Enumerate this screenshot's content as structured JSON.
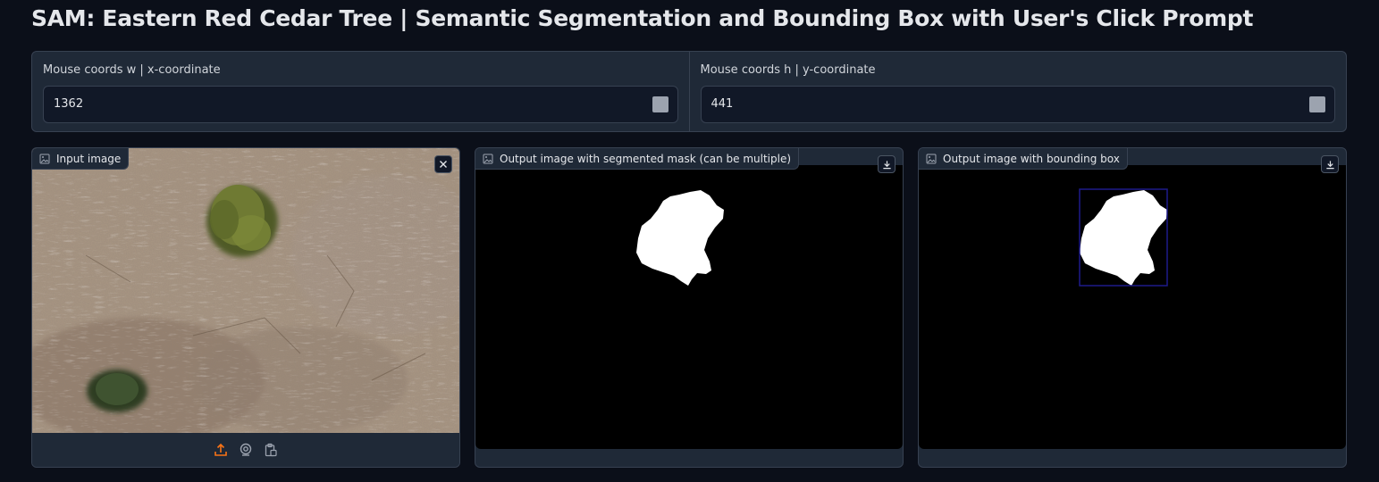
{
  "title": "SAM: Eastern Red Cedar Tree | Semantic Segmentation and Bounding Box with User's Click Prompt",
  "coords": {
    "x": {
      "label": "Mouse coords w | x-coordinate",
      "value": "1362"
    },
    "y": {
      "label": "Mouse coords h | y-coordinate",
      "value": "441"
    }
  },
  "panels": {
    "input": {
      "label": "Input image",
      "label_icon": "image-icon",
      "close_icon": "close-icon"
    },
    "mask": {
      "label": "Output image with segmented mask (can be multiple)",
      "label_icon": "image-icon",
      "download_icon": "download-icon"
    },
    "bbox": {
      "label": "Output image with bounding box",
      "label_icon": "image-icon",
      "download_icon": "download-icon"
    }
  },
  "toolbar": {
    "upload_icon": "upload-icon",
    "webcam_icon": "webcam-icon",
    "clipboard_icon": "clipboard-icon"
  },
  "colors": {
    "background": "#0b0f19",
    "panel": "#1f2937",
    "border": "#374151",
    "accent_upload": "#f97316",
    "mask": "#ffffff",
    "bbox_stroke": "#1e1b8a"
  }
}
